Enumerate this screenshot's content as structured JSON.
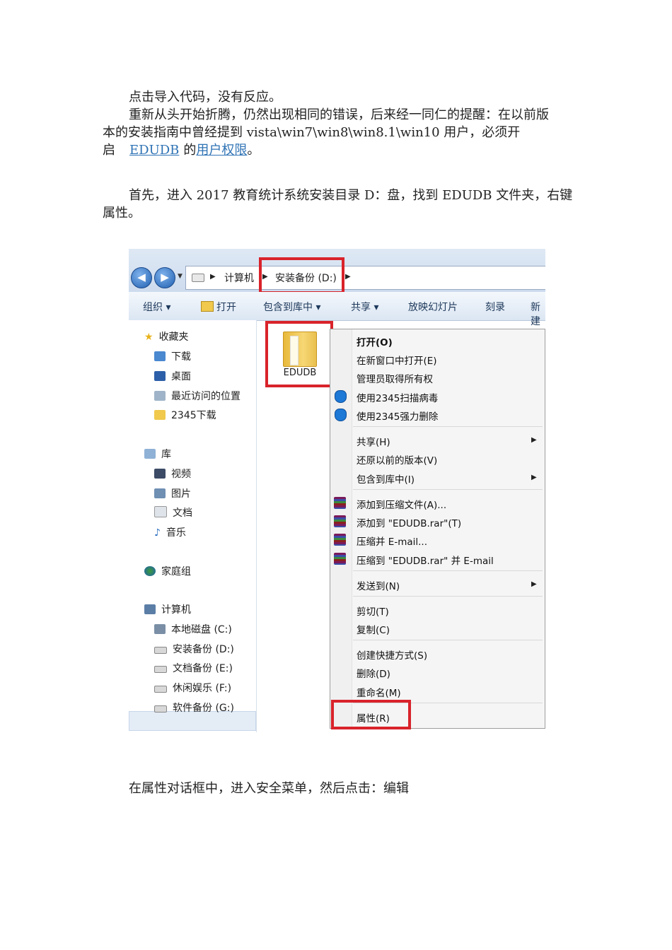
{
  "doc": {
    "para1": "点击导入代码，没有反应。",
    "para2_line1": "重新从头开始折腾，仍然出现相同的错误，后来经一同仁的提醒：在以前版",
    "para2_line2": "本的安装指南中曾经提到 vista\\win7\\win8\\win8.1\\win10 用户，必须开",
    "para2_line3_prefix": "启",
    "para2_link1": "EDUDB",
    "para2_mid": "的",
    "para2_link2": "用户权限",
    "para2_end": "。",
    "para3_line1": "首先，进入 2017 教育统计系统安装目录 D：盘，找到 EDUDB 文件夹，右键",
    "para3_line2": "属性。",
    "para4": "在属性对话框中，进入安全菜单，然后点击：编辑"
  },
  "screenshot": {
    "breadcrumb": [
      "计算机",
      "安装备份 (D:)"
    ],
    "toolbar": [
      "组织 ▾",
      "打开",
      "包含到库中 ▾",
      "共享 ▾",
      "放映幻灯片",
      "刻录",
      "新建"
    ],
    "nav": {
      "favorites": "收藏夹",
      "fav_items": [
        "下载",
        "桌面",
        "最近访问的位置",
        "2345下载"
      ],
      "libraries": "库",
      "lib_items": [
        "视频",
        "图片",
        "文档",
        "音乐"
      ],
      "homegroup": "家庭组",
      "computer": "计算机",
      "drives": [
        "本地磁盘 (C:)",
        "安装备份 (D:)",
        "文档备份 (E:)",
        "休闲娱乐 (F:)",
        "软件备份 (G:)"
      ]
    },
    "folder_label": "EDUDB",
    "context_menu": [
      "打开(O)",
      "在新窗口中打开(E)",
      "管理员取得所有权",
      "使用2345扫描病毒",
      "使用2345强力删除",
      "共享(H)",
      "还原以前的版本(V)",
      "包含到库中(I)",
      "添加到压缩文件(A)...",
      "添加到 \"EDUDB.rar\"(T)",
      "压缩并 E-mail...",
      "压缩到 \"EDUDB.rar\" 并 E-mail",
      "发送到(N)",
      "剪切(T)",
      "复制(C)",
      "创建快捷方式(S)",
      "删除(D)",
      "重命名(M)",
      "属性(R)"
    ],
    "colors": {
      "highlight_box": "#d9232b",
      "link": "#2f73b5",
      "folder": "#f2c94c"
    }
  }
}
